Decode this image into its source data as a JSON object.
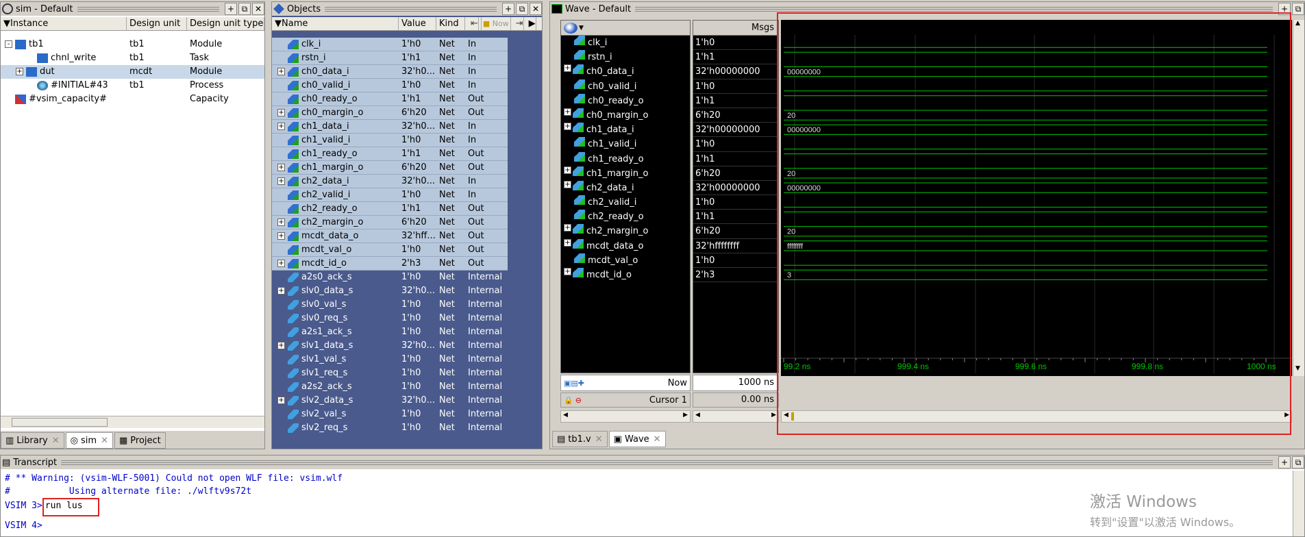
{
  "sim_panel": {
    "title": "sim - Default",
    "columns": [
      "Instance",
      "Design unit",
      "Design unit type"
    ],
    "rows": [
      {
        "instance": "tb1",
        "unit": "tb1",
        "type": "Module",
        "indent": 0,
        "expander": "-",
        "icon": "module-icon"
      },
      {
        "instance": "chnl_write",
        "unit": "tb1",
        "type": "Task",
        "indent": 2,
        "expander": "",
        "icon": "task-icon"
      },
      {
        "instance": "dut",
        "unit": "mcdt",
        "type": "Module",
        "indent": 1,
        "expander": "+",
        "icon": "module-icon",
        "selected": true
      },
      {
        "instance": "#INITIAL#43",
        "unit": "tb1",
        "type": "Process",
        "indent": 2,
        "expander": "",
        "icon": "process-icon"
      },
      {
        "instance": "#vsim_capacity#",
        "unit": "",
        "type": "Capacity",
        "indent": 0,
        "expander": "",
        "icon": "capacity-icon"
      }
    ],
    "tabs": [
      "Library",
      "sim",
      "Project"
    ]
  },
  "objects_panel": {
    "title": "Objects",
    "columns": [
      "Name",
      "Value",
      "Kind"
    ],
    "toolbar_now": "Now",
    "rows": [
      {
        "name": "clk_i",
        "value": "1'h0",
        "kind": "Net",
        "mode": "In",
        "exp": false
      },
      {
        "name": "rstn_i",
        "value": "1'h1",
        "kind": "Net",
        "mode": "In",
        "exp": false
      },
      {
        "name": "ch0_data_i",
        "value": "32'h0...",
        "kind": "Net",
        "mode": "In",
        "exp": true
      },
      {
        "name": "ch0_valid_i",
        "value": "1'h0",
        "kind": "Net",
        "mode": "In",
        "exp": false
      },
      {
        "name": "ch0_ready_o",
        "value": "1'h1",
        "kind": "Net",
        "mode": "Out",
        "exp": false
      },
      {
        "name": "ch0_margin_o",
        "value": "6'h20",
        "kind": "Net",
        "mode": "Out",
        "exp": true
      },
      {
        "name": "ch1_data_i",
        "value": "32'h0...",
        "kind": "Net",
        "mode": "In",
        "exp": true
      },
      {
        "name": "ch1_valid_i",
        "value": "1'h0",
        "kind": "Net",
        "mode": "In",
        "exp": false
      },
      {
        "name": "ch1_ready_o",
        "value": "1'h1",
        "kind": "Net",
        "mode": "Out",
        "exp": false
      },
      {
        "name": "ch1_margin_o",
        "value": "6'h20",
        "kind": "Net",
        "mode": "Out",
        "exp": true
      },
      {
        "name": "ch2_data_i",
        "value": "32'h0...",
        "kind": "Net",
        "mode": "In",
        "exp": true
      },
      {
        "name": "ch2_valid_i",
        "value": "1'h0",
        "kind": "Net",
        "mode": "In",
        "exp": false
      },
      {
        "name": "ch2_ready_o",
        "value": "1'h1",
        "kind": "Net",
        "mode": "Out",
        "exp": false
      },
      {
        "name": "ch2_margin_o",
        "value": "6'h20",
        "kind": "Net",
        "mode": "Out",
        "exp": true
      },
      {
        "name": "mcdt_data_o",
        "value": "32'hff...",
        "kind": "Net",
        "mode": "Out",
        "exp": true
      },
      {
        "name": "mcdt_val_o",
        "value": "1'h0",
        "kind": "Net",
        "mode": "Out",
        "exp": false
      },
      {
        "name": "mcdt_id_o",
        "value": "2'h3",
        "kind": "Net",
        "mode": "Out",
        "exp": true
      },
      {
        "name": "a2s0_ack_s",
        "value": "1'h0",
        "kind": "Net",
        "mode": "Internal",
        "exp": false
      },
      {
        "name": "slv0_data_s",
        "value": "32'h0...",
        "kind": "Net",
        "mode": "Internal",
        "exp": true
      },
      {
        "name": "slv0_val_s",
        "value": "1'h0",
        "kind": "Net",
        "mode": "Internal",
        "exp": false
      },
      {
        "name": "slv0_req_s",
        "value": "1'h0",
        "kind": "Net",
        "mode": "Internal",
        "exp": false
      },
      {
        "name": "a2s1_ack_s",
        "value": "1'h0",
        "kind": "Net",
        "mode": "Internal",
        "exp": false
      },
      {
        "name": "slv1_data_s",
        "value": "32'h0...",
        "kind": "Net",
        "mode": "Internal",
        "exp": true
      },
      {
        "name": "slv1_val_s",
        "value": "1'h0",
        "kind": "Net",
        "mode": "Internal",
        "exp": false
      },
      {
        "name": "slv1_req_s",
        "value": "1'h0",
        "kind": "Net",
        "mode": "Internal",
        "exp": false
      },
      {
        "name": "a2s2_ack_s",
        "value": "1'h0",
        "kind": "Net",
        "mode": "Internal",
        "exp": false
      },
      {
        "name": "slv2_data_s",
        "value": "32'h0...",
        "kind": "Net",
        "mode": "Internal",
        "exp": true
      },
      {
        "name": "slv2_val_s",
        "value": "1'h0",
        "kind": "Net",
        "mode": "Internal",
        "exp": false
      },
      {
        "name": "slv2_req_s",
        "value": "1'h0",
        "kind": "Net",
        "mode": "Internal",
        "exp": false
      }
    ]
  },
  "wave_panel": {
    "title": "Wave - Default",
    "msgs_label": "Msgs",
    "signals": [
      {
        "name": "clk_i",
        "value": "1'h0",
        "exp": false,
        "wave": "low"
      },
      {
        "name": "rstn_i",
        "value": "1'h1",
        "exp": false,
        "wave": "high"
      },
      {
        "name": "ch0_data_i",
        "value": "32'h00000000",
        "exp": true,
        "wave": "bus",
        "label": "00000000"
      },
      {
        "name": "ch0_valid_i",
        "value": "1'h0",
        "exp": false,
        "wave": "low"
      },
      {
        "name": "ch0_ready_o",
        "value": "1'h1",
        "exp": false,
        "wave": "high"
      },
      {
        "name": "ch0_margin_o",
        "value": "6'h20",
        "exp": true,
        "wave": "bus",
        "label": "20"
      },
      {
        "name": "ch1_data_i",
        "value": "32'h00000000",
        "exp": true,
        "wave": "bus",
        "label": "00000000"
      },
      {
        "name": "ch1_valid_i",
        "value": "1'h0",
        "exp": false,
        "wave": "low"
      },
      {
        "name": "ch1_ready_o",
        "value": "1'h1",
        "exp": false,
        "wave": "high"
      },
      {
        "name": "ch1_margin_o",
        "value": "6'h20",
        "exp": true,
        "wave": "bus",
        "label": "20"
      },
      {
        "name": "ch2_data_i",
        "value": "32'h00000000",
        "exp": true,
        "wave": "bus",
        "label": "00000000"
      },
      {
        "name": "ch2_valid_i",
        "value": "1'h0",
        "exp": false,
        "wave": "low"
      },
      {
        "name": "ch2_ready_o",
        "value": "1'h1",
        "exp": false,
        "wave": "high"
      },
      {
        "name": "ch2_margin_o",
        "value": "6'h20",
        "exp": true,
        "wave": "bus",
        "label": "20"
      },
      {
        "name": "mcdt_data_o",
        "value": "32'hffffffff",
        "exp": true,
        "wave": "bus",
        "label": "ffffffff"
      },
      {
        "name": "mcdt_val_o",
        "value": "1'h0",
        "exp": false,
        "wave": "low"
      },
      {
        "name": "mcdt_id_o",
        "value": "2'h3",
        "exp": true,
        "wave": "bus",
        "label": "3"
      }
    ],
    "now_label": "Now",
    "now_value": "1000 ns",
    "cursor_label": "Cursor 1",
    "cursor_value": "0.00 ns",
    "time_ticks": [
      "99.2 ns",
      "999.4 ns",
      "999.6 ns",
      "999.8 ns",
      "1000 ns"
    ],
    "tabs": [
      "tb1.v",
      "Wave"
    ]
  },
  "transcript": {
    "title": "Transcript",
    "lines": [
      {
        "text": "# ** Warning: (vsim-WLF-5001) Could not open WLF file: vsim.wlf",
        "color": "#0000c8"
      },
      {
        "text": "#           Using alternate file: ./wlftv9s72t",
        "color": "#0000c8"
      }
    ],
    "prompt1": "VSIM 3>",
    "command": "run lus",
    "prompt2": "VSIM 4>"
  },
  "watermark": {
    "line1": "激活 Windows",
    "line2": "转到\"设置\"以激活 Windows。"
  },
  "colors": {
    "objects_bg": "#4a5a8c",
    "objects_sel": "#b8c8dc",
    "wave_bg": "#000000",
    "wave_green": "#00c800",
    "highlight_red": "#e02020"
  }
}
